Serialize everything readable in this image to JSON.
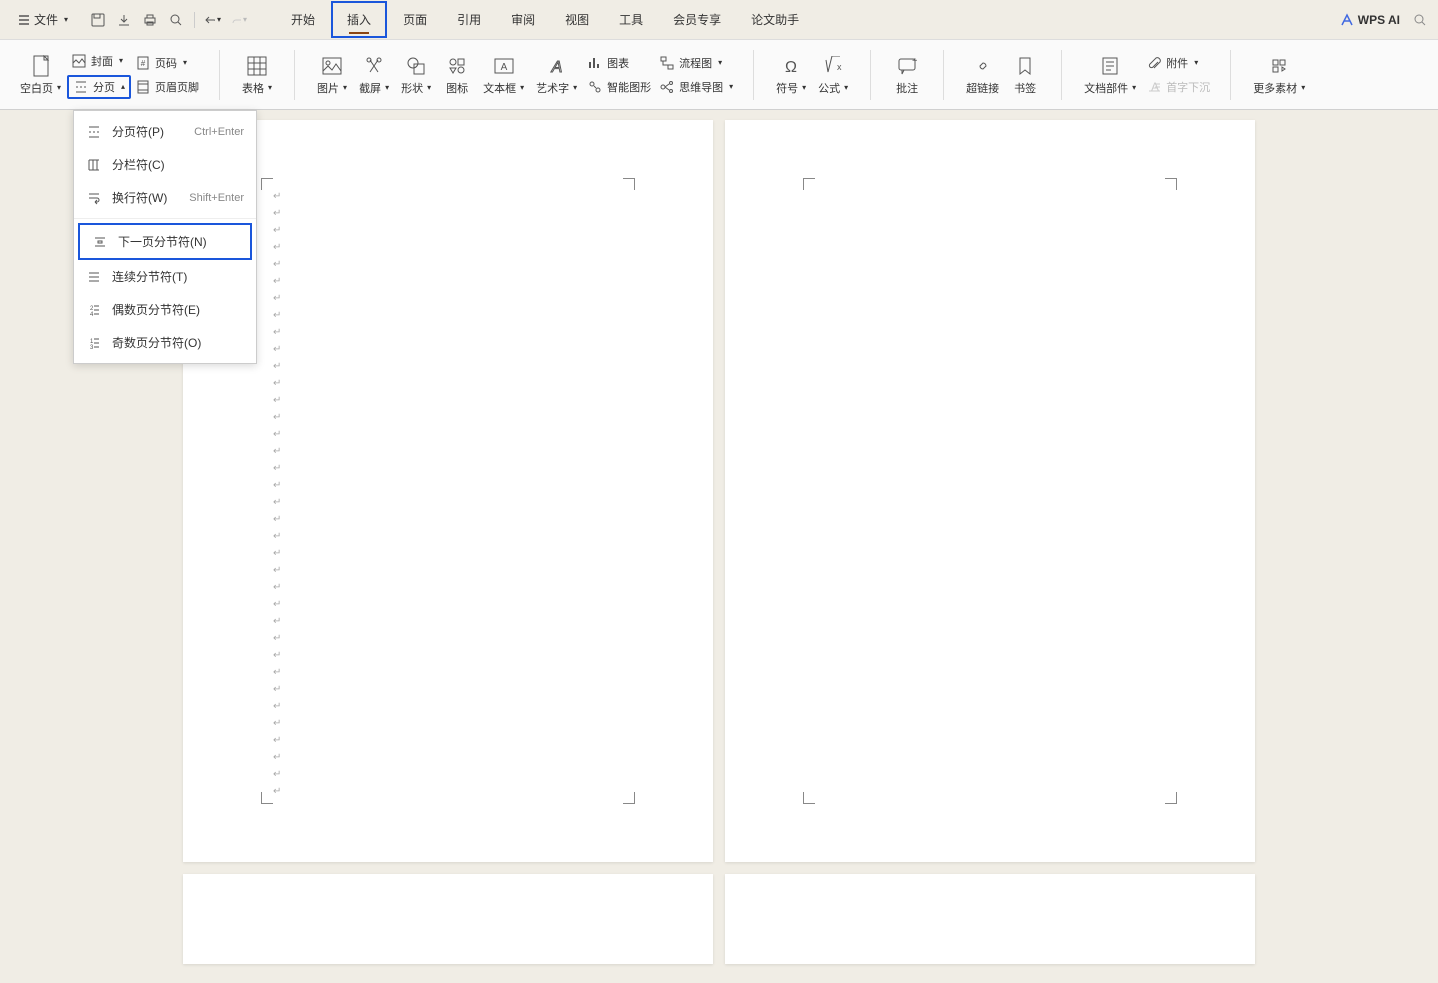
{
  "topbar": {
    "file": "文件",
    "wps_ai": "WPS AI"
  },
  "tabs": {
    "start": "开始",
    "insert": "插入",
    "page": "页面",
    "reference": "引用",
    "review": "审阅",
    "view": "视图",
    "tools": "工具",
    "member": "会员专享",
    "thesis": "论文助手"
  },
  "ribbon": {
    "blank_page": "空白页",
    "cover": "封面",
    "page_number": "页码",
    "page_break": "分页",
    "header_footer": "页眉页脚",
    "table": "表格",
    "picture": "图片",
    "screenshot": "截屏",
    "shape": "形状",
    "icon": "图标",
    "textbox": "文本框",
    "wordart": "艺术字",
    "chart": "图表",
    "flowchart": "流程图",
    "smartart": "智能图形",
    "mindmap": "思维导图",
    "symbol": "符号",
    "equation": "公式",
    "comment": "批注",
    "hyperlink": "超链接",
    "bookmark": "书签",
    "doc_parts": "文档部件",
    "dropcap": "首字下沉",
    "attachment": "附件",
    "more_material": "更多素材"
  },
  "dropdown": {
    "page_break": "分页符(P)",
    "page_break_sc": "Ctrl+Enter",
    "column_break": "分栏符(C)",
    "text_wrap": "换行符(W)",
    "text_wrap_sc": "Shift+Enter",
    "next_page": "下一页分节符(N)",
    "continuous": "连续分节符(T)",
    "even_page": "偶数页分节符(E)",
    "odd_page": "奇数页分节符(O)"
  }
}
